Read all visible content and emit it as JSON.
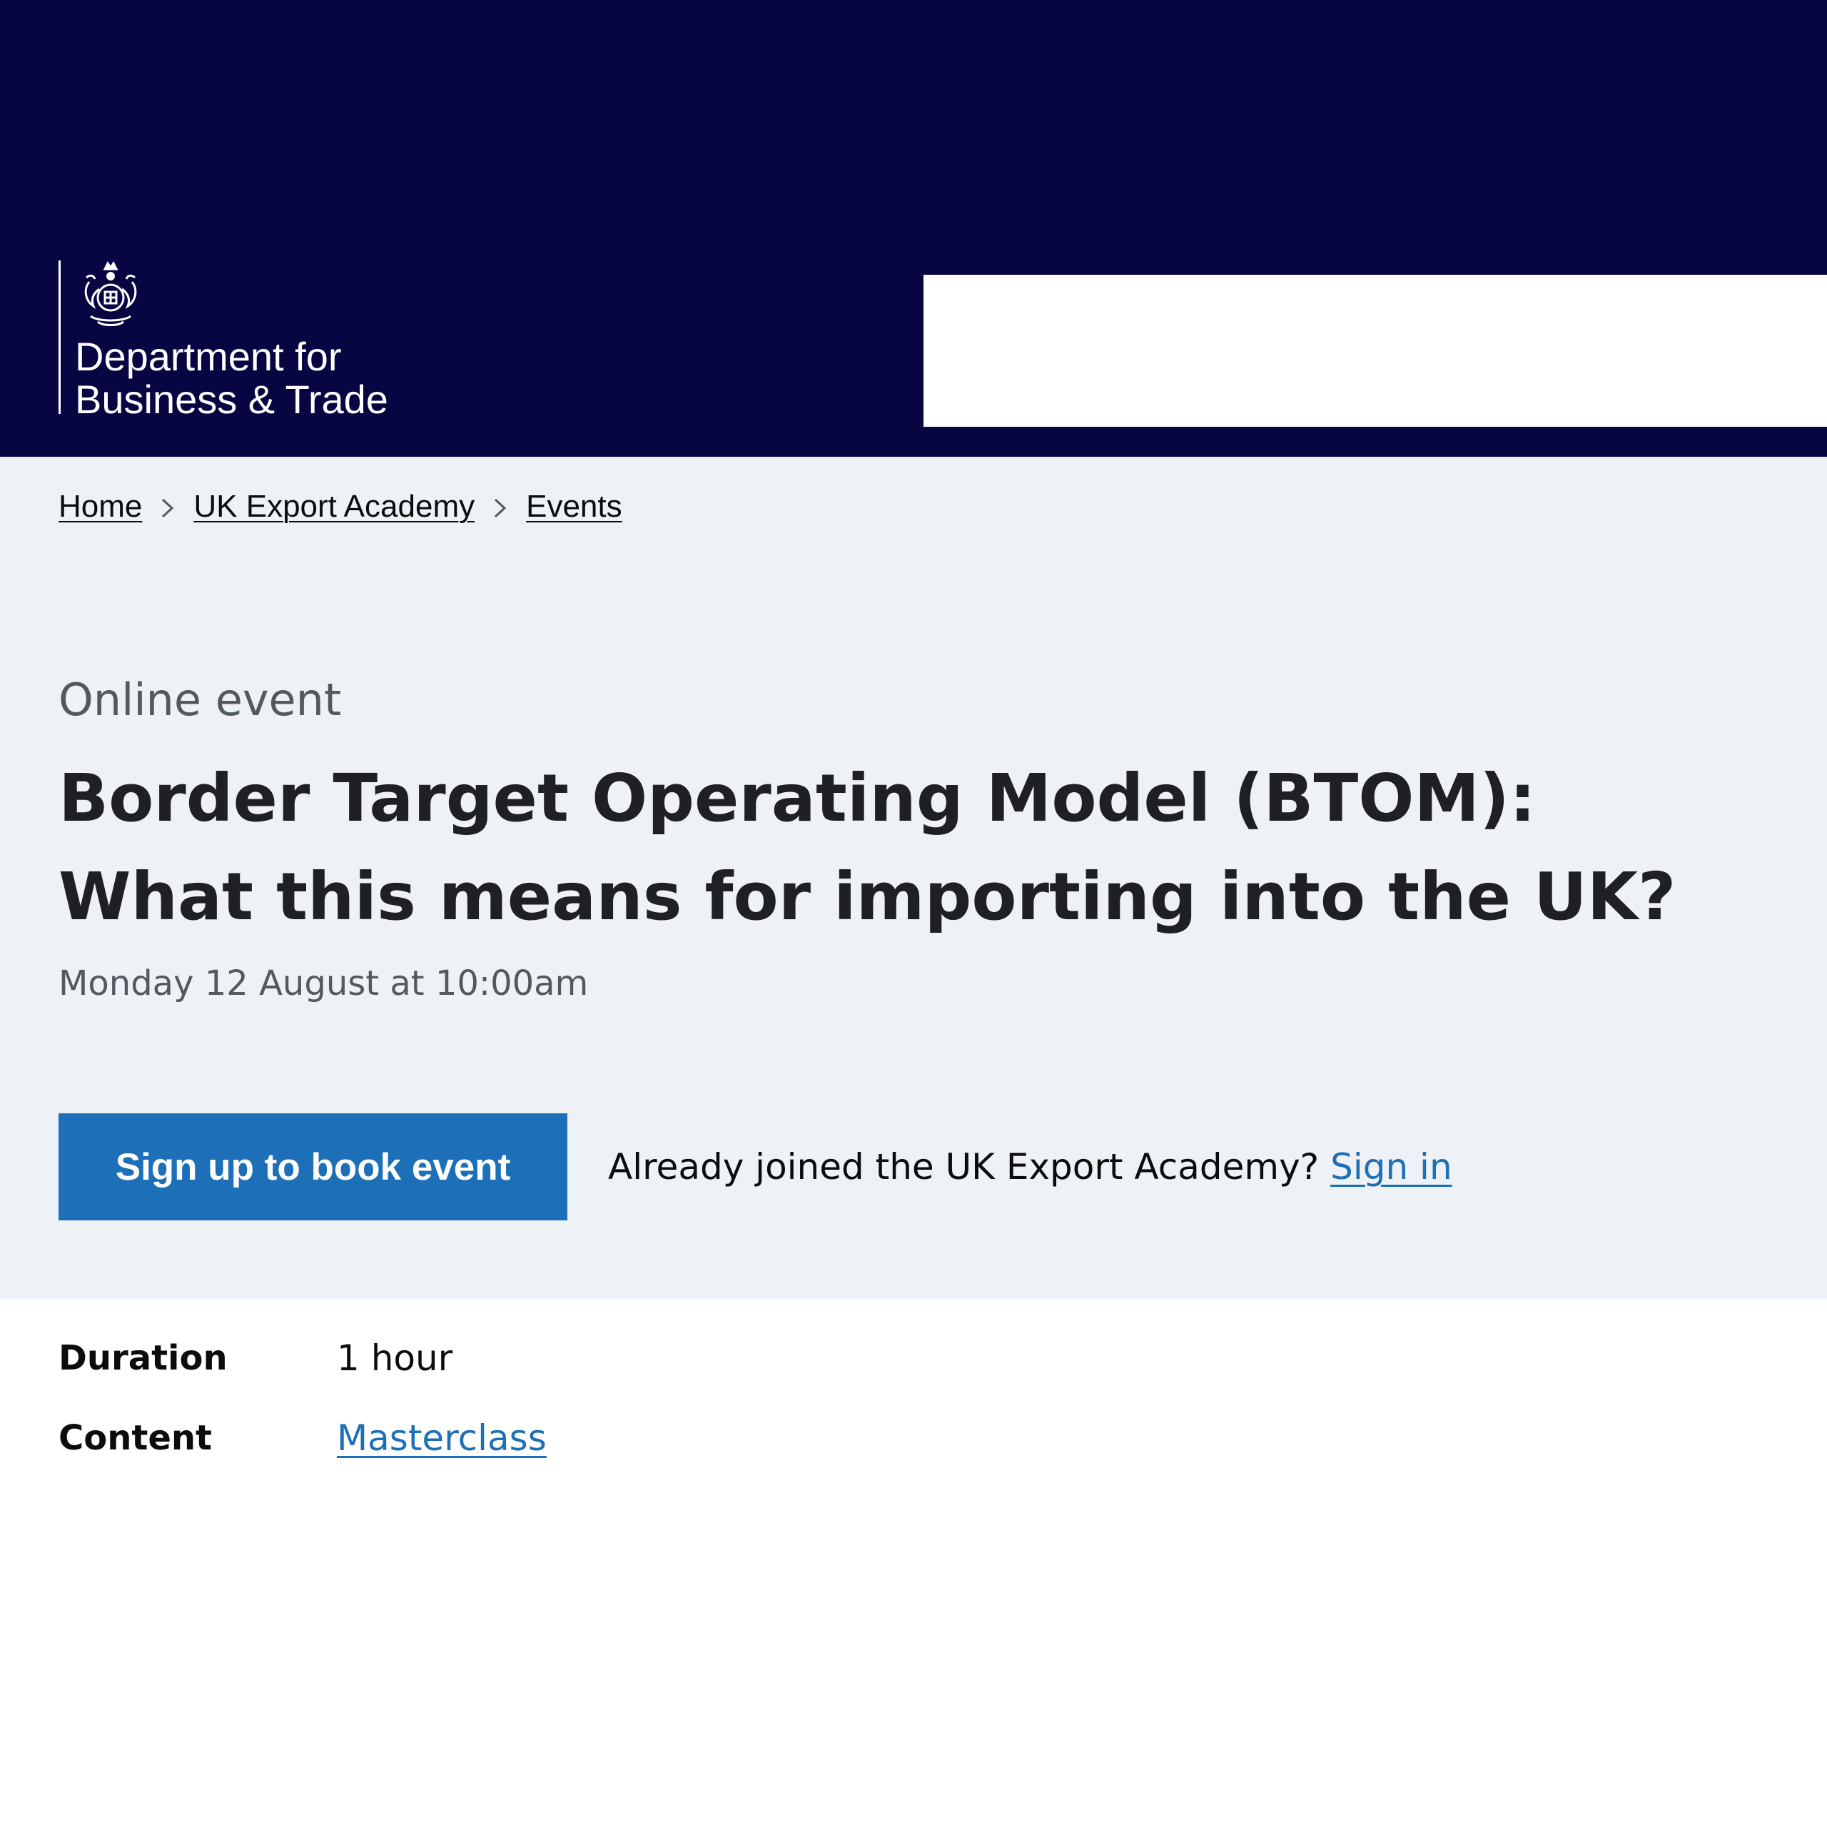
{
  "header": {
    "logo_line_1": "Department for",
    "logo_line_2": "Business & Trade",
    "background_color": "#070642"
  },
  "breadcrumbs": [
    {
      "label": "Home"
    },
    {
      "label": "UK Export Academy"
    },
    {
      "label": "Events"
    }
  ],
  "event": {
    "type": "Online event",
    "title": "Border Target Operating Model (BTOM): What this means for importing into the UK?",
    "date": "Monday 12 August at 10:00am"
  },
  "cta": {
    "button_label": "Sign up to book event",
    "already_text": "Already joined the UK Export Academy? ",
    "signin_label": "Sign in",
    "accent_color": "#1d70b8"
  },
  "details": [
    {
      "key": "Duration",
      "value": "1 hour"
    },
    {
      "key": "Content",
      "value": "Masterclass"
    }
  ]
}
